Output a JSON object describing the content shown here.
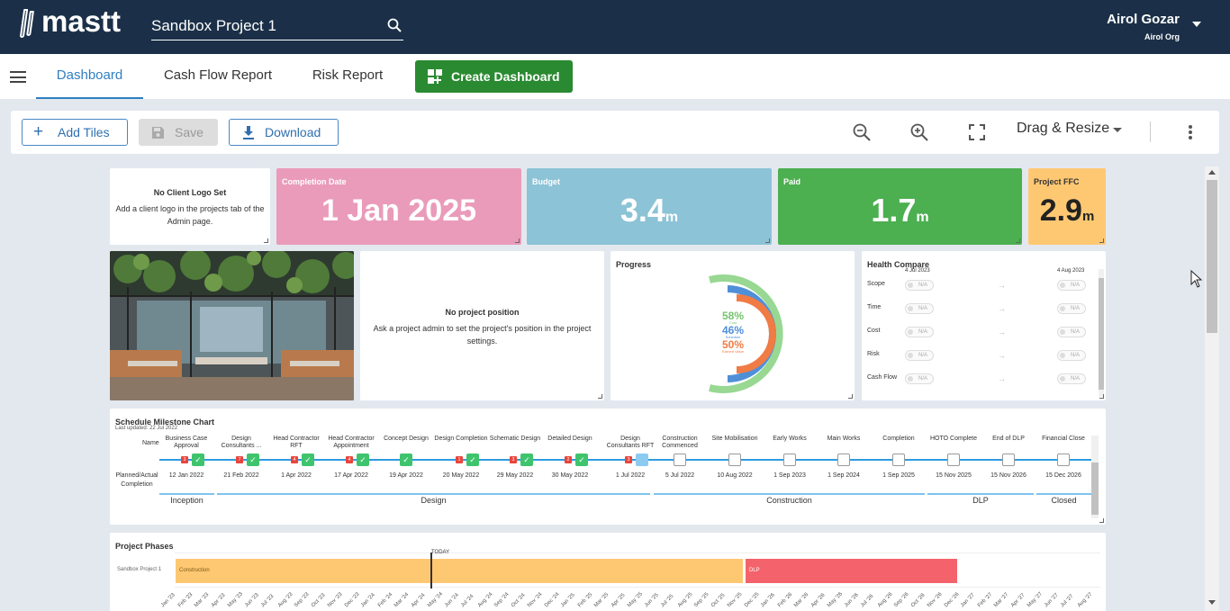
{
  "app": {
    "brand": "mastt",
    "project": "Sandbox Project 1"
  },
  "user": {
    "name": "Airol Gozar",
    "org": "Airol Org"
  },
  "nav": {
    "tabs": [
      "Dashboard",
      "Cash Flow Report",
      "Risk Report"
    ],
    "create_label": "Create Dashboard"
  },
  "toolbar": {
    "add_tiles": "Add Tiles",
    "save": "Save",
    "download": "Download",
    "mode": "Drag & Resize"
  },
  "tiles": {
    "logo": {
      "title": "No Client Logo Set",
      "text": "Add a client logo in the projects tab of the Admin page."
    },
    "completion": {
      "label": "Completion Date",
      "value": "1 Jan 2025",
      "color": "#ea9bb9"
    },
    "budget": {
      "label": "Budget",
      "value": "3.4",
      "unit": "m",
      "color": "#8cc3d6"
    },
    "paid": {
      "label": "Paid",
      "value": "1.7",
      "unit": "m",
      "color": "#4caf50"
    },
    "ffc": {
      "label": "Project FFC",
      "value": "2.9",
      "unit": "m",
      "color": "#fec873"
    },
    "position": {
      "title": "No project position",
      "text": "Ask a project admin to set the project's position in the project settings."
    },
    "progress": {
      "title": "Progress",
      "cost": "58%",
      "cost_label": "Cost",
      "schedule": "46%",
      "schedule_label": "Schedule",
      "earned": "50%",
      "earned_label": "Earned Value"
    },
    "health": {
      "title": "Health Compare",
      "date_a": "4 Jul 2023",
      "date_b": "4 Aug 2023",
      "na": "N/A",
      "rows": [
        "Scope",
        "Time",
        "Cost",
        "Risk",
        "Cash Flow"
      ]
    }
  },
  "milestones": {
    "title": "Schedule Milestone Chart",
    "updated": "Last updated: 22 Jul 2022",
    "name_label": "Name",
    "planned_label": "Planned/Actual Completion",
    "items": [
      {
        "name": "Business Case Approval",
        "date": "12 Jan 2022",
        "badge": "3",
        "state": "done"
      },
      {
        "name": "Design Consultants ...",
        "date": "21 Feb 2022",
        "badge": "7",
        "state": "done"
      },
      {
        "name": "Head Contractor RFT",
        "date": "1 Apr 2022",
        "badge": "4",
        "state": "done"
      },
      {
        "name": "Head Contractor Appointment",
        "date": "17 Apr 2022",
        "badge": "4",
        "state": "done"
      },
      {
        "name": "Concept Design",
        "date": "19 Apr 2022",
        "badge": "",
        "state": "done"
      },
      {
        "name": "Design Completion",
        "date": "20 May 2022",
        "badge": "1",
        "state": "done"
      },
      {
        "name": "Schematic Design",
        "date": "29 May 2022",
        "badge": "3",
        "state": "done"
      },
      {
        "name": "Detailed Design",
        "date": "30 May 2022",
        "badge": "2",
        "state": "done"
      },
      {
        "name": "Design Consultants RFT",
        "date": "1 Jul 2022",
        "badge": "3",
        "state": "progress"
      },
      {
        "name": "Construction Commenced",
        "date": "5 Jul 2022",
        "badge": "",
        "state": "open"
      },
      {
        "name": "Site Mobilisation",
        "date": "10 Aug 2022",
        "badge": "",
        "state": "open"
      },
      {
        "name": "Early Works",
        "date": "1 Sep 2023",
        "badge": "",
        "state": "open"
      },
      {
        "name": "Main Works",
        "date": "1 Sep 2024",
        "badge": "",
        "state": "open"
      },
      {
        "name": "Completion",
        "date": "1 Sep 2025",
        "badge": "",
        "state": "open"
      },
      {
        "name": "HOTO Complete",
        "date": "15 Nov 2025",
        "badge": "",
        "state": "open"
      },
      {
        "name": "End of DLP",
        "date": "15 Nov 2026",
        "badge": "",
        "state": "open"
      },
      {
        "name": "Financial Close",
        "date": "15 Dec 2026",
        "badge": "",
        "state": "open"
      }
    ],
    "phases": [
      "Inception",
      "Design",
      "Construction",
      "DLP",
      "Closed"
    ]
  },
  "phases_chart": {
    "title": "Project Phases",
    "row_label": "Sandbox Project 1",
    "today": "TODAY",
    "bars": [
      {
        "label": "Construction",
        "color": "#fec873"
      },
      {
        "label": "DLP",
        "color": "#f4636c"
      }
    ],
    "months": [
      "Jan '23",
      "Feb '23",
      "Mar '23",
      "Apr '23",
      "May '23",
      "Jun '23",
      "Jul '23",
      "Aug '23",
      "Sep '23",
      "Oct '23",
      "Nov '23",
      "Dec '23",
      "Jan '24",
      "Feb '24",
      "Mar '24",
      "Apr '24",
      "May '24",
      "Jun '24",
      "Jul '24",
      "Aug '24",
      "Sep '24",
      "Oct '24",
      "Nov '24",
      "Dec '24",
      "Jan '25",
      "Feb '25",
      "Mar '25",
      "Apr '25",
      "May '25",
      "Jun '25",
      "Jul '25",
      "Aug '25",
      "Sep '25",
      "Oct '25",
      "Nov '25",
      "Dec '25",
      "Jan '26",
      "Feb '26",
      "Mar '26",
      "Apr '26",
      "May '26",
      "Jun '26",
      "Jul '26",
      "Aug '26",
      "Sep '26",
      "Oct '26",
      "Nov '26",
      "Dec '26",
      "Jan '27",
      "Feb '27",
      "Mar '27",
      "Apr '27",
      "May '27",
      "Jun '27",
      "Jul '27",
      "Aug '27"
    ]
  }
}
